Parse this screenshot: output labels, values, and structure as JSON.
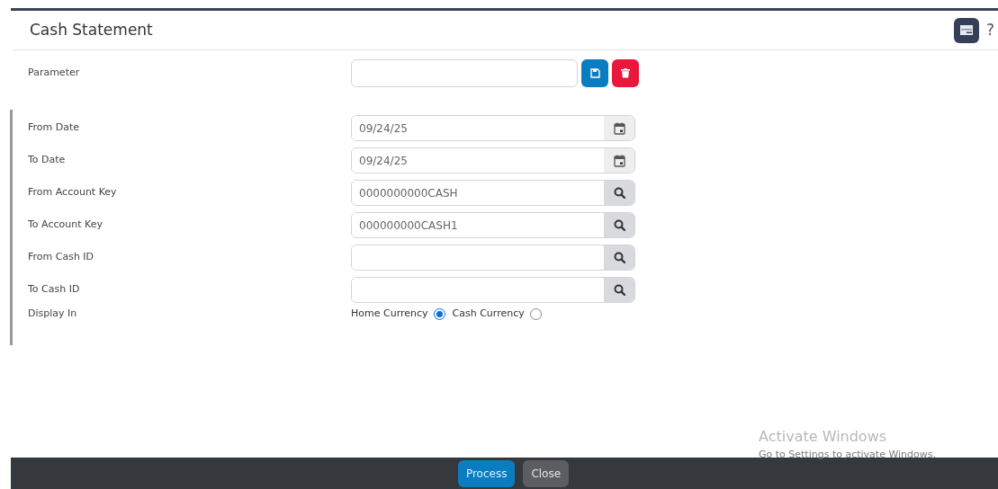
{
  "title": "Cash Statement",
  "toolbar": {
    "help": "?"
  },
  "fields": [
    {
      "label": "Parameter",
      "kind": "parameter"
    },
    {
      "label": "From Date",
      "kind": "date",
      "value": "09/24/25"
    },
    {
      "label": "To Date",
      "kind": "date",
      "value": "09/24/25"
    },
    {
      "label": "From Account Key",
      "kind": "lookup",
      "value": "0000000000CASH"
    },
    {
      "label": "To Account Key",
      "kind": "lookup",
      "value": "000000000CASH1"
    },
    {
      "label": "From Cash ID",
      "kind": "lookup"
    },
    {
      "label": "To Cash ID",
      "kind": "lookup"
    }
  ],
  "display_in": {
    "label": "Display In",
    "options": [
      {
        "label": "Home Currency",
        "selected": true
      },
      {
        "label": "Cash Currency",
        "selected": false
      }
    ]
  },
  "buttons": [
    "Process",
    "Close"
  ],
  "os_notice": {
    "title": "Activate Windows",
    "subtitle": "Go to Settings to activate Windows."
  }
}
